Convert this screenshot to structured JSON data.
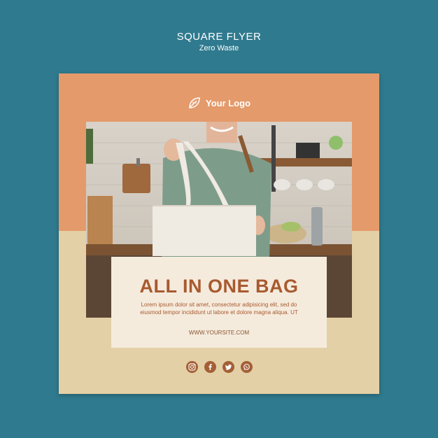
{
  "header": {
    "title": "SQUARE FLYER",
    "subtitle": "Zero Waste"
  },
  "flyer": {
    "logo_text": "Your Logo",
    "headline": "ALL IN ONE BAG",
    "body": "Lorem ipsum dolor sit amet, consectetur adipisicing elit, sed do eiusmod tempor incididunt ut labore et dolore magna aliqua. UT",
    "website": "WWW.YOURSITE.COM",
    "social_icons": [
      "instagram-icon",
      "facebook-icon",
      "twitter-icon",
      "whatsapp-icon"
    ]
  },
  "colors": {
    "background": "#2f7a8e",
    "top_band": "#e49a6a",
    "bottom_band": "#e4d0a6",
    "card": "#f5ebdd",
    "accent": "#a85a2f"
  }
}
